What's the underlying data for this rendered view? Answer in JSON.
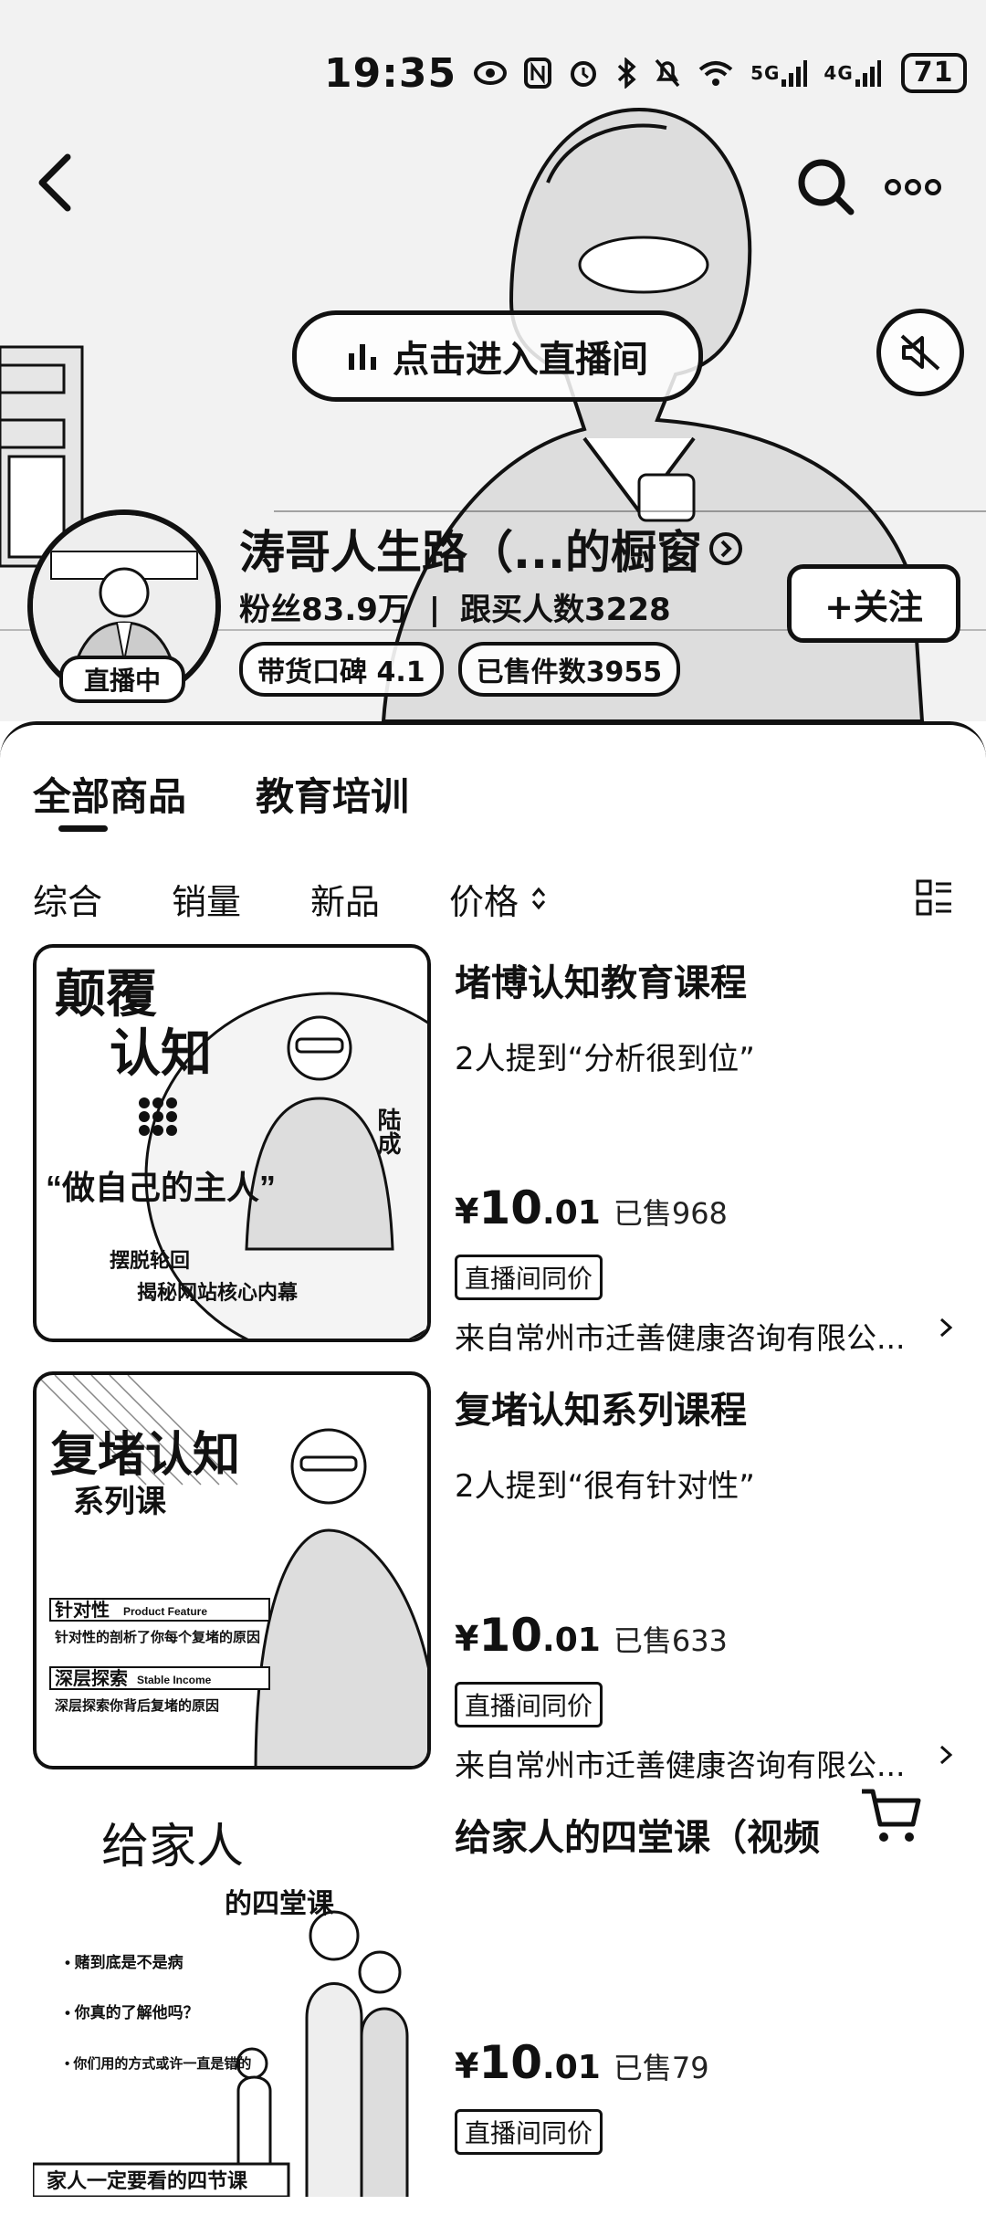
{
  "status_bar": {
    "time": "19:35",
    "battery": "71",
    "icons": [
      "eye-icon",
      "nfc-icon",
      "alarm-icon",
      "bluetooth-icon",
      "mute-icon",
      "wifi-icon",
      "signal-5g-icon",
      "signal-4g-icon",
      "battery-icon"
    ],
    "signal_1": "5G",
    "signal_2": "4G"
  },
  "header": {
    "back_icon": "chevron-left-icon",
    "search_icon": "search-icon",
    "more_icon": "more-icon",
    "enter_live_label": "点击进入直播间",
    "mute_icon": "speaker-mute-icon",
    "shop_name": "涛哥人生路（...的橱窗",
    "fans": "粉丝83.9万",
    "buyers": "跟买人数3228",
    "rating": "带货口碑 4.1",
    "sold_count": "已售件数3955",
    "live_tag": "直播中",
    "follow_label": "+关注"
  },
  "tabs": [
    "全部商品",
    "教育培训"
  ],
  "active_tab": 0,
  "sort": {
    "items": [
      "综合",
      "销量",
      "新品",
      "价格"
    ],
    "layout_icon": "list-layout-icon"
  },
  "products": [
    {
      "title": "堵博认知教育课程",
      "mention": "2人提到“分析很到位”",
      "currency": "¥",
      "price_int": "10",
      "price_dec": ".01",
      "sold": "已售968",
      "same_price": "直播间同价",
      "seller": "来自常州市迁善健康咨询有限公...",
      "thumb": {
        "big1": "颠覆",
        "big2": "认知",
        "quote": "“做自己的主人”",
        "name": "陆成",
        "line1": "摆脱轮回",
        "line2": "揭秘网站核心内幕"
      }
    },
    {
      "title": "复堵认知系列课程",
      "mention": "2人提到“很有针对性”",
      "currency": "¥",
      "price_int": "10",
      "price_dec": ".01",
      "sold": "已售633",
      "same_price": "直播间同价",
      "seller": "来自常州市迁善健康咨询有限公...",
      "thumb": {
        "big1": "复堵认知",
        "big2": "系列课",
        "tag1": "针对性",
        "tag1_en": "Product Feature",
        "line1": "针对性的剖析了你每个复堵的原因",
        "tag2": "深层探索",
        "tag2_en": "Stable Income",
        "line2": "深层探索你背后复堵的原因"
      }
    },
    {
      "title": "给家人的四堂课（视频",
      "currency": "¥",
      "price_int": "10",
      "price_dec": ".01",
      "sold": "已售79",
      "same_price": "直播间同价",
      "thumb": {
        "big1": "给家人",
        "big2": "的四堂课",
        "b1": "• 赌到底是不是病",
        "b2": "• 你真的了解他吗？",
        "b3": "• 你们用的方式或许一直是错的",
        "footer": "家人一定要看的四节课"
      }
    }
  ],
  "cart_icon": "shopping-cart-icon"
}
